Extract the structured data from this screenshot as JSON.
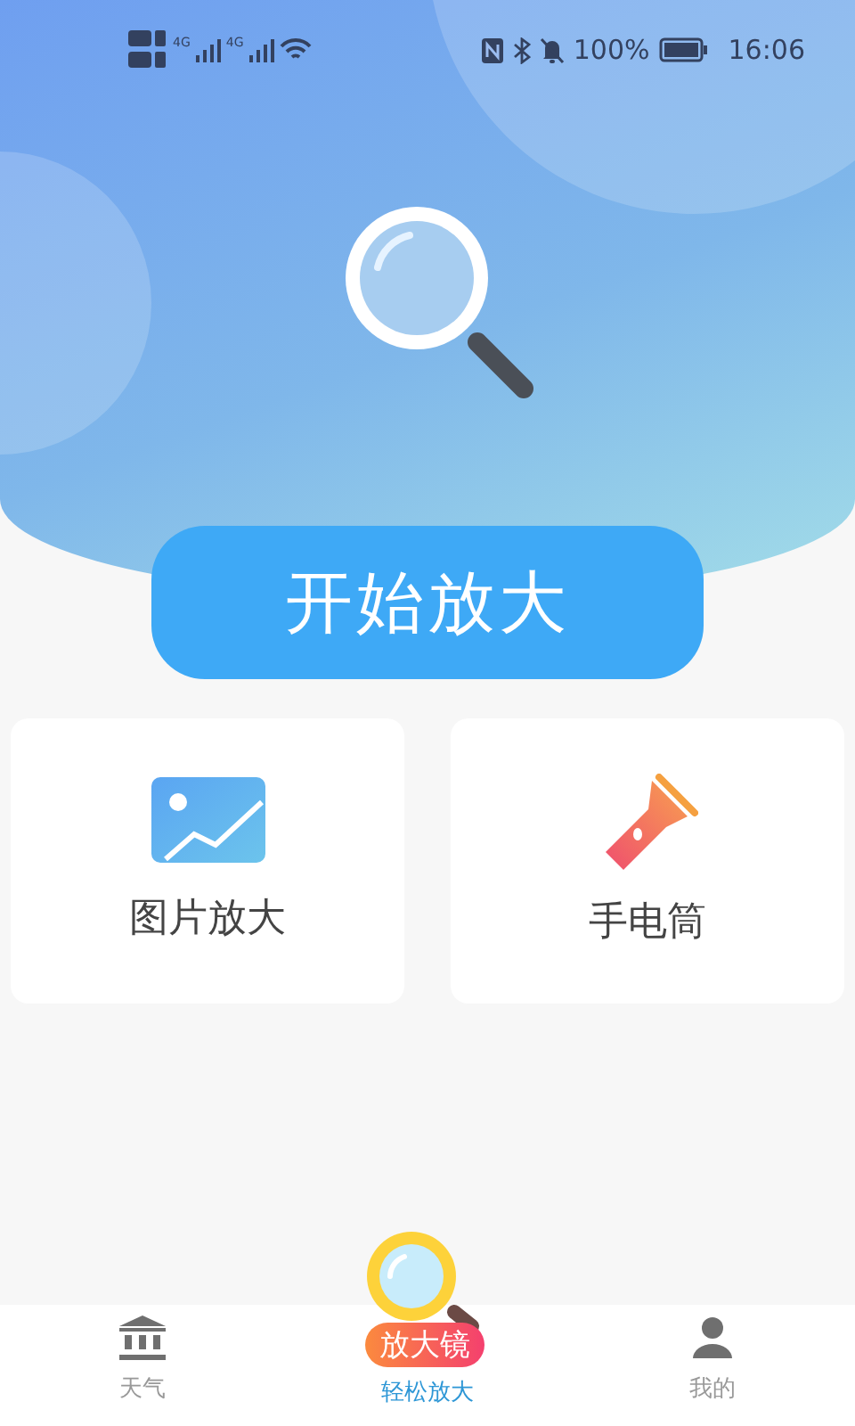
{
  "status_bar": {
    "network": [
      "4G",
      "4G"
    ],
    "battery": "100%",
    "time": "16:06"
  },
  "start_button": "开始放大",
  "tools": [
    {
      "kind": "image",
      "label": "图片放大"
    },
    {
      "kind": "flashlight",
      "label": "手电筒"
    }
  ],
  "tabs": [
    {
      "kind": "weather",
      "label": "天气",
      "selected": false
    },
    {
      "kind": "magnifier",
      "badge": "放大镜",
      "label": "轻松放大",
      "selected": true
    },
    {
      "kind": "me",
      "label": "我的",
      "selected": false
    }
  ]
}
